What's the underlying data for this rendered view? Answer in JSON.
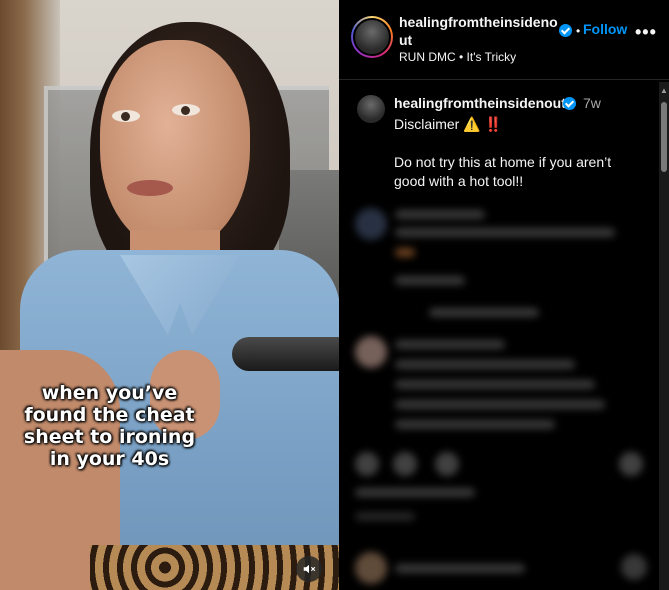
{
  "video": {
    "caption": "when you’ve found the cheat sheet to ironing in your 40s",
    "mute_icon": "speaker-muted-icon"
  },
  "header": {
    "username": "healingfromtheinsidenout",
    "separator": "•",
    "follow_label": "Follow",
    "more_label": "•••",
    "audio": "RUN DMC • It's Tricky"
  },
  "post": {
    "username": "healingfromtheinsidenout",
    "time": "7w",
    "line1": "Disclaimer ⚠️ ‼️",
    "line2": "Do not try this at home if you aren’t good with a hot tool!!"
  },
  "colors": {
    "accent": "#0095f6",
    "background": "#000000",
    "secondary_text": "#a8a8a8"
  }
}
